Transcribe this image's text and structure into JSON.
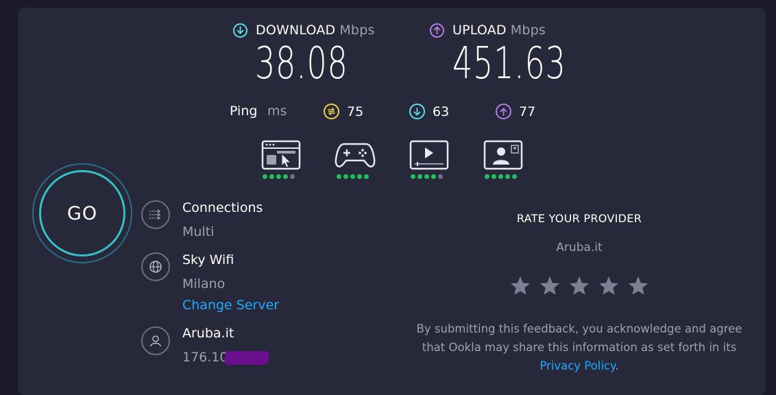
{
  "download": {
    "label": "DOWNLOAD",
    "unit": "Mbps",
    "value": "38.08",
    "icon": "download-arrow-icon",
    "color": "#5ee0e8"
  },
  "upload": {
    "label": "UPLOAD",
    "unit": "Mbps",
    "value": "451.63",
    "icon": "upload-arrow-icon",
    "color": "#b57cf0"
  },
  "ping": {
    "label": "Ping",
    "unit": "ms",
    "idle": {
      "value": "75",
      "icon": "ping-idle-icon",
      "color": "#f2d04a"
    },
    "download": {
      "value": "63",
      "icon": "ping-download-icon",
      "color": "#5ee0e8"
    },
    "upload": {
      "value": "77",
      "icon": "ping-upload-icon",
      "color": "#b57cf0"
    }
  },
  "experience": [
    {
      "icon": "web-browsing-icon",
      "rating": 4,
      "max": 5
    },
    {
      "icon": "gaming-controller-icon",
      "rating": 5,
      "max": 5
    },
    {
      "icon": "video-streaming-icon",
      "rating": 4,
      "max": 5
    },
    {
      "icon": "video-call-icon",
      "rating": 5,
      "max": 5
    }
  ],
  "go_button": {
    "label": "GO"
  },
  "connections": {
    "title": "Connections",
    "value": "Multi",
    "icon": "connections-icon"
  },
  "server": {
    "title": "Sky Wifi",
    "location": "Milano",
    "change_label": "Change Server",
    "icon": "globe-icon"
  },
  "provider": {
    "title": "Aruba.it",
    "ip": "176.107",
    "icon": "user-icon"
  },
  "rate": {
    "title": "RATE YOUR PROVIDER",
    "provider": "Aruba.it",
    "stars": 5,
    "disclaimer_line1": "By submitting this feedback, you acknowledge and agree",
    "disclaimer_line2": "that Ookla may share this information as set forth in its",
    "privacy_link": "Privacy Policy",
    "privacy_suffix": "."
  },
  "colors": {
    "link": "#1fa9ff",
    "good": "#20c05c",
    "ring": "#34c0c5"
  }
}
